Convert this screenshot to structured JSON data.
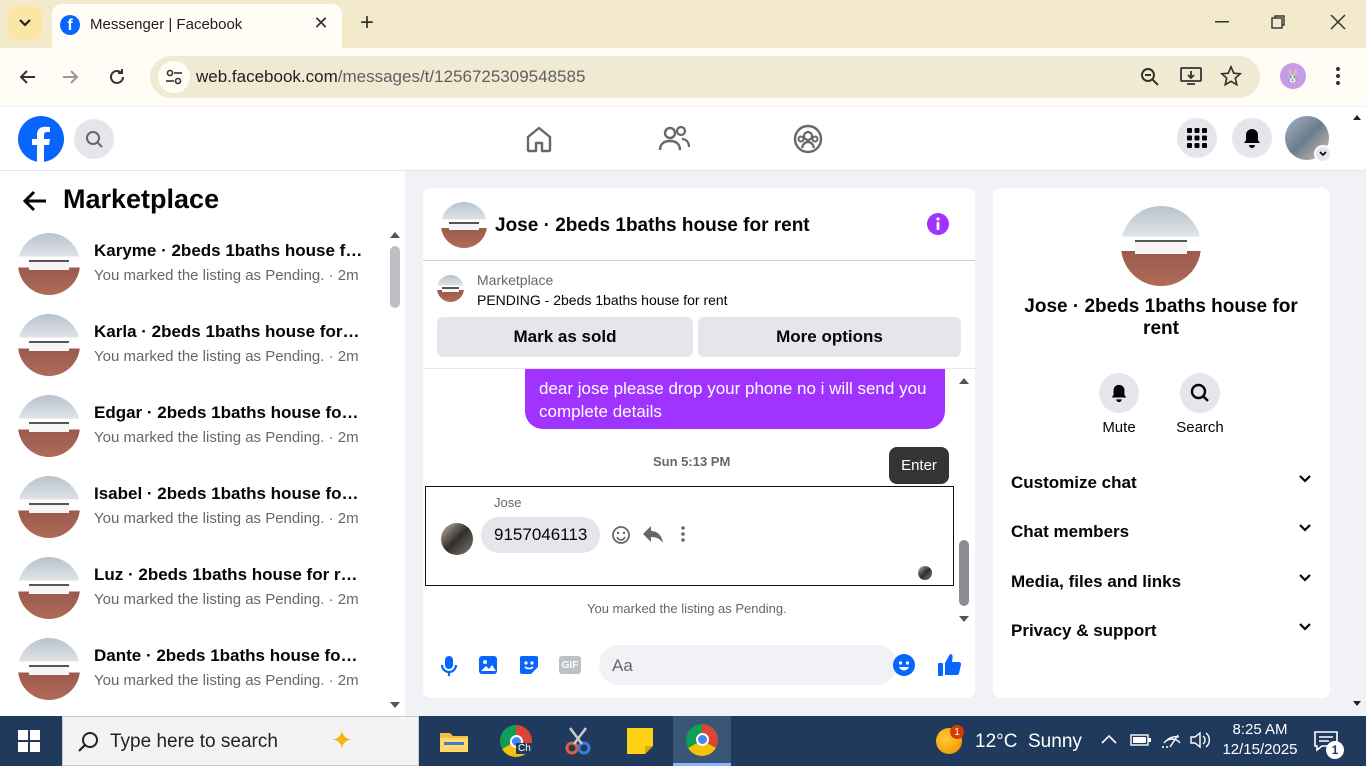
{
  "browser": {
    "tab_title": "Messenger | Facebook",
    "url_host": "web.facebook.com",
    "url_path": "/messages/t/1256725309548585"
  },
  "sidebar": {
    "title": "Marketplace",
    "conversations": [
      {
        "name": "Karyme · 2beds 1baths house fo...",
        "sub": "You marked the listing as Pending. · 2m"
      },
      {
        "name": "Karla · 2beds 1baths house for r...",
        "sub": "You marked the listing as Pending. · 2m"
      },
      {
        "name": "Edgar · 2beds 1baths house for r...",
        "sub": "You marked the listing as Pending. · 2m"
      },
      {
        "name": "Isabel · 2beds 1baths house for r...",
        "sub": "You marked the listing as Pending. · 2m"
      },
      {
        "name": "Luz · 2beds 1baths house for rent",
        "sub": "You marked the listing as Pending. · 2m"
      },
      {
        "name": "Dante · 2beds 1baths house for ...",
        "sub": "You marked the listing as Pending. · 2m"
      }
    ]
  },
  "chat": {
    "title": "Jose · 2beds 1baths house for rent",
    "listing_label": "Marketplace",
    "listing_status": "PENDING - 2beds 1baths house for rent",
    "mark_sold": "Mark as sold",
    "more_options": "More options",
    "sent_message": "dear jose please drop your phone no i will send you complete details",
    "timestamp": "Sun 5:13 PM",
    "enter_tooltip": "Enter",
    "sender_name": "Jose",
    "received_message": "9157046113",
    "system_note": "You marked the listing as Pending.",
    "composer_placeholder": "Aa",
    "gif_label": "GIF"
  },
  "info": {
    "name": "Jose · 2beds 1baths house for rent",
    "mute": "Mute",
    "search": "Search",
    "sections": [
      "Customize chat",
      "Chat members",
      "Media, files and links",
      "Privacy & support"
    ]
  },
  "taskbar": {
    "search_placeholder": "Type here to search",
    "weather": "12°C  Sunny",
    "weather_badge": "1",
    "time": "8:25 AM",
    "date": "12/15/2025",
    "notif_count": "1",
    "chrome_label": "Ch"
  },
  "colors": {
    "fb_blue": "#0866ff",
    "messenger_purple": "#a033ff",
    "taskbar": "#1f3a5c"
  }
}
